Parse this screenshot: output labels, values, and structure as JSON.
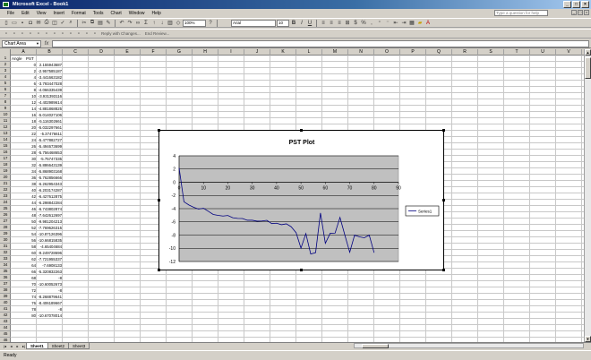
{
  "window": {
    "title": "Microsoft Excel - Book1"
  },
  "menu": {
    "items": [
      "File",
      "Edit",
      "View",
      "Insert",
      "Format",
      "Tools",
      "Chart",
      "Window",
      "Help"
    ],
    "help_placeholder": "Type a question for help"
  },
  "toolbar": {
    "zoom": "100%",
    "font_name": "Arial",
    "font_size": "10",
    "reply_text": "Reply with Changes...",
    "end_review_text": "End Review..."
  },
  "formula_bar": {
    "name_box": "Chart Area",
    "fx": "fx",
    "value": ""
  },
  "sheet": {
    "columns": [
      "A",
      "B",
      "C",
      "D",
      "E",
      "F",
      "G",
      "H",
      "I",
      "J",
      "K",
      "L",
      "M",
      "N",
      "O",
      "P",
      "Q",
      "R",
      "S",
      "T",
      "U",
      "V"
    ],
    "rows": [
      "1",
      "2",
      "3",
      "4",
      "5",
      "6",
      "7",
      "8",
      "9",
      "10",
      "11",
      "12",
      "13",
      "14",
      "15",
      "16",
      "17",
      "18",
      "19",
      "20",
      "21",
      "22",
      "23",
      "24",
      "25",
      "26",
      "27",
      "28",
      "29",
      "30",
      "31",
      "32",
      "33",
      "34",
      "35",
      "36",
      "37",
      "38",
      "39",
      "40",
      "41",
      "42",
      "43",
      "44",
      "45",
      "46"
    ],
    "header_a": "Angle",
    "header_b": "PST",
    "col_a": [
      "0",
      "2",
      "4",
      "6",
      "8",
      "10",
      "12",
      "14",
      "16",
      "18",
      "20",
      "22",
      "24",
      "26",
      "28",
      "30",
      "32",
      "34",
      "36",
      "38",
      "40",
      "42",
      "44",
      "46",
      "48",
      "50",
      "52",
      "54",
      "56",
      "58",
      "60",
      "62",
      "64",
      "66",
      "68",
      "70",
      "72",
      "74",
      "76",
      "78",
      "80"
    ],
    "col_b": [
      "2.155943687",
      "-2.957585187",
      "-3.441663182",
      "-3.793447028",
      "-4.066335439",
      "-3.931393116",
      "-4.402989614",
      "-4.881868825",
      "-5.014027106",
      "-5.116302661",
      "-5.032297661",
      "-5.37476611",
      "-5.477882727",
      "-5.494673699",
      "-5.756468653",
      "-5.75747335",
      "-5.886643139",
      "-5.868903168",
      "-5.762856666",
      "-6.262954343",
      "-6.203174287",
      "-6.427612875",
      "-6.298842284",
      "-6.743802874",
      "-7.642612697",
      "-9.981204213",
      "-7.769626315",
      "-10.87126396",
      "-10.66815835",
      "-4.65404684",
      "-9.249728696",
      "-7.721955337",
      "-7.6908133",
      "-5.320832263",
      "-8",
      "-10.60052673",
      "-8",
      "-8.268879641",
      "-8.406189667",
      "-8",
      "-10.67078014"
    ]
  },
  "chart_data": {
    "type": "line",
    "title": "PST Plot",
    "series": [
      {
        "name": "Series1",
        "x": [
          0,
          2,
          4,
          6,
          8,
          10,
          12,
          14,
          16,
          18,
          20,
          22,
          24,
          26,
          28,
          30,
          32,
          34,
          36,
          38,
          40,
          42,
          44,
          46,
          48,
          50,
          52,
          54,
          56,
          58,
          60,
          62,
          64,
          66,
          68,
          70,
          72,
          74,
          76,
          78,
          80
        ],
        "values": [
          2.156,
          -2.958,
          -3.442,
          -3.793,
          -4.066,
          -3.931,
          -4.403,
          -4.882,
          -5.014,
          -5.116,
          -5.032,
          -5.375,
          -5.478,
          -5.495,
          -5.756,
          -5.757,
          -5.887,
          -5.869,
          -5.763,
          -6.263,
          -6.203,
          -6.428,
          -6.299,
          -6.744,
          -7.643,
          -9.981,
          -7.77,
          -10.871,
          -10.668,
          -4.654,
          -9.25,
          -7.722,
          -7.691,
          -5.321,
          -8,
          -10.601,
          -8,
          -8.269,
          -8.406,
          -8,
          -10.671
        ]
      }
    ],
    "x_ticks": [
      "0",
      "10",
      "20",
      "30",
      "40",
      "50",
      "60",
      "70",
      "80",
      "90"
    ],
    "y_ticks": [
      "4",
      "2",
      "0",
      "-2",
      "-4",
      "-6",
      "-8",
      "-10",
      "-12"
    ],
    "xlim": [
      0,
      90
    ],
    "ylim": [
      -12,
      4
    ],
    "legend_position": "right",
    "grid": true,
    "plot_background": "#c0c0c0",
    "line_color": "#000080"
  },
  "tabs": [
    "Sheet1",
    "Sheet2",
    "Sheet3"
  ],
  "status": {
    "text": "Ready"
  }
}
